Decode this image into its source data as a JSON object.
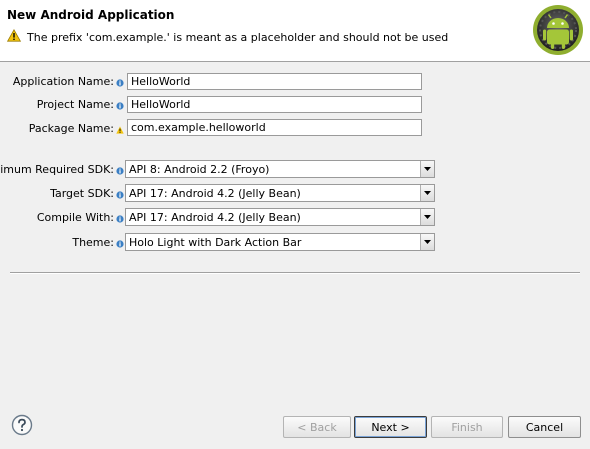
{
  "header": {
    "title": "New Android Application",
    "message": "The prefix 'com.example.' is meant as a placeholder and should not be used"
  },
  "form": {
    "application_name": {
      "label": "Application Name:",
      "value": "HelloWorld"
    },
    "project_name": {
      "label": "Project Name:",
      "value": "HelloWorld"
    },
    "package_name": {
      "label": "Package Name:",
      "value": "com.example.helloworld"
    },
    "min_sdk": {
      "label": "Minimum Required SDK:",
      "value": "API 8: Android 2.2 (Froyo)"
    },
    "target_sdk": {
      "label": "Target SDK:",
      "value": "API 17: Android 4.2 (Jelly Bean)"
    },
    "compile_with": {
      "label": "Compile With:",
      "value": "API 17: Android 4.2 (Jelly Bean)"
    },
    "theme": {
      "label": "Theme:",
      "value": "Holo Light with Dark Action Bar"
    }
  },
  "buttons": {
    "back": "< Back",
    "next": "Next >",
    "finish": "Finish",
    "cancel": "Cancel"
  },
  "colors": {
    "android_green": "#9fbf3b",
    "info_blue": "#3b7fc4",
    "warning_yellow": "#f2c40f"
  }
}
